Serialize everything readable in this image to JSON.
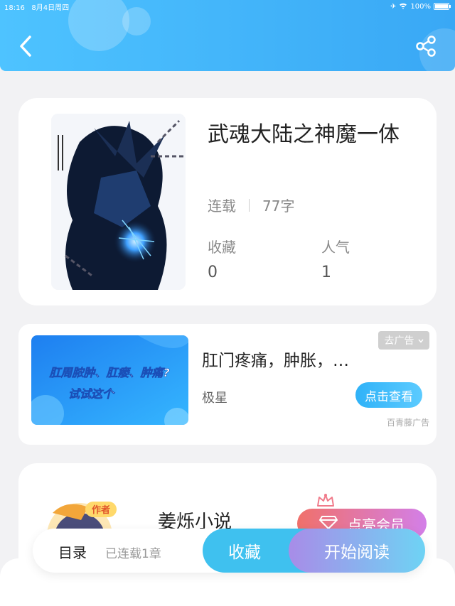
{
  "status_bar": {
    "time": "18:16",
    "date": "8月4日周四",
    "battery": "100%"
  },
  "book": {
    "title": "武魂大陆之神魔一体",
    "status": "连载",
    "word_count": "77字",
    "favorites_label": "收藏",
    "favorites_value": "0",
    "popularity_label": "人气",
    "popularity_value": "1"
  },
  "ad": {
    "close_label": "去广告",
    "image_text_line1": "肛周脓肿、肛瘘、肿痛?",
    "image_text_line2": "试试这个",
    "title": "肛门疼痛，肿胀，…",
    "source": "极星",
    "button_label": "点击查看",
    "tag": "百青藤广告"
  },
  "author": {
    "badge": "作者",
    "name": "姜烁小说",
    "vip_button": "点亮会员"
  },
  "bottom_bar": {
    "toc_label": "目录",
    "chapters_text": "已连载1章",
    "favorite_button": "收藏",
    "read_button": "开始阅读"
  },
  "colors": {
    "header": "#39a8f5",
    "accent": "#3fc1ef"
  }
}
